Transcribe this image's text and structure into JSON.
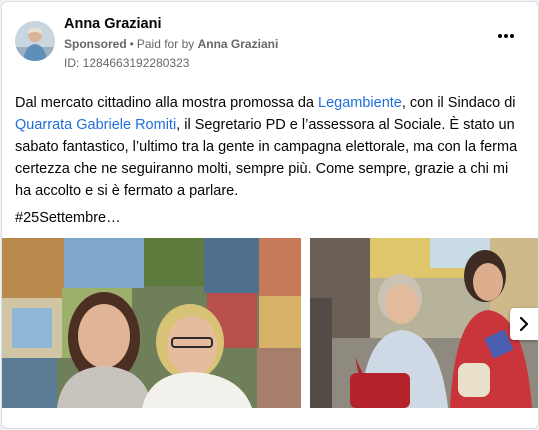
{
  "ad": {
    "advertiser_name": "Anna Graziani",
    "sponsored_label": "Sponsored",
    "paid_for_label": "Paid for by",
    "paid_for_name": "Anna Graziani",
    "id_label": "ID: 1284663192280323",
    "more_icon": "more-horizontal-icon"
  },
  "post": {
    "text_1": "Dal mercato cittadino alla mostra promossa da ",
    "link_1": "Legambiente",
    "text_2": ", con il Sindaco di ",
    "link_2": "Quarrata Gabriele Romiti",
    "text_3": ", il Segretario PD e l’assessora al Sociale. È stato un sabato fantastico, l’ultimo tra la gente in campagna elettorale, ma con la ferma certezza che ne seguiranno molti, sempre più. Come sempre, grazie a chi mi ha accolto e si è fermato a parlare.",
    "hashtag": "#25Settembre…"
  },
  "carousel": {
    "next_icon": "chevron-right-icon"
  },
  "colors": {
    "link": "#216fdb",
    "text": "#050505",
    "secondary": "#65676b"
  }
}
